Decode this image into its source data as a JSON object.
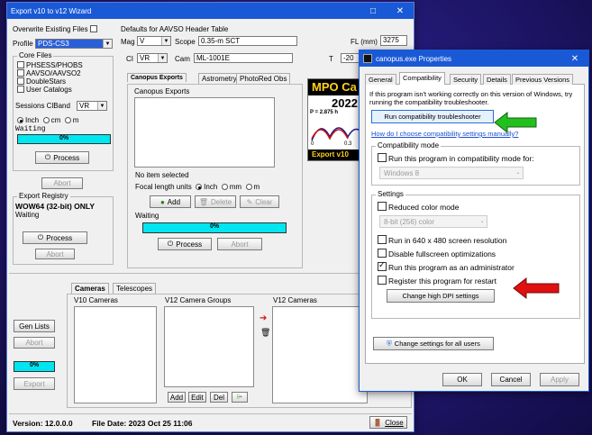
{
  "wizard": {
    "title": "Export v10 to v12 Wizard",
    "overwrite_label": "Overwrite Existing Files",
    "profile_label": "Profile",
    "profile_value": "PDS-CS3",
    "core_files_label": "Core Files",
    "core_files": [
      "PHSESS/PHOBS",
      "AAVSO/AAVSO2",
      "DoubleStars",
      "User Catalogs"
    ],
    "sessions_label": "Sessions ClBand",
    "sessions_value": "VR",
    "units": [
      "Inch",
      "cm",
      "m"
    ],
    "waiting": "Waiting",
    "progress_text": "0%",
    "process": "Process",
    "abort": "Abort",
    "export_registry_label": "Export Registry",
    "wow64": "WOW64 (32-bit) ONLY",
    "defaults_label": "Defaults for AAVSO Header Table",
    "mag_label": "Mag",
    "mag_value": "V",
    "scope_label": "Scope",
    "scope_value": "0.35-m SCT",
    "fl_label": "FL (mm)",
    "fl_value": "3275",
    "ci_label": "CI",
    "ci_value": "VR",
    "cam_label": "Cam",
    "cam_value": "ML-1001E",
    "t_label": "T",
    "t_value": "-20",
    "tabs": [
      "Canopus Exports",
      "Astrometry",
      "PhotoRed Obs"
    ],
    "canopus_exports_label": "Canopus Exports",
    "no_item": "No item selected",
    "focal_label": "Focal length units",
    "add": "Add",
    "delete": "Delete",
    "clear": "Clear",
    "banner": {
      "title": "MPO Ca",
      "year": "2022",
      "formula": "P = 2.875 h",
      "tick_left": "0",
      "tick_right": "0.3",
      "footer": "Export v10"
    },
    "cam_tabs": [
      "Cameras",
      "Telescopes"
    ],
    "v10_cameras": "V10 Cameras",
    "v12_groups": "V12 Camera Groups",
    "v12_cameras": "V12 Cameras",
    "gen_lists": "Gen Lists",
    "export": "Export",
    "edit": "Edit",
    "del": "Del",
    "version": "Version: 12.0.0.0",
    "file_date": "File Date: 2023 Oct 25  11:06",
    "close": "Close",
    "minimize": "–",
    "close_x": "✕"
  },
  "props": {
    "title": "canopus.exe Properties",
    "tabs": [
      "General",
      "Compatibility",
      "Security",
      "Details",
      "Previous Versions"
    ],
    "intro": "If this program isn't working correctly on this version of Windows, try running the compatibility troubleshooter.",
    "run_troubleshooter": "Run compatibility troubleshooter",
    "how_link": "How do I choose compatibility settings manually?",
    "compat_mode_label": "Compatibility mode",
    "compat_mode_check": "Run this program in compatibility mode for:",
    "compat_os": "Windows 8",
    "settings_label": "Settings",
    "reduced_color": "Reduced color mode",
    "color_value": "8-bit (256) color",
    "run_640": "Run in 640 x 480 screen resolution",
    "disable_fullscreen": "Disable fullscreen optimizations",
    "run_admin": "Run this program as an administrator",
    "register_restart": "Register this program for restart",
    "high_dpi": "Change high DPI settings",
    "change_all": "Change settings for all users",
    "ok": "OK",
    "cancel": "Cancel",
    "apply": "Apply",
    "close_x": "✕"
  },
  "colors": {
    "title_bar": "#1a59d6",
    "progress": "#00e6f0",
    "green_arrow": "#22c01e",
    "red_arrow": "#e01010"
  }
}
